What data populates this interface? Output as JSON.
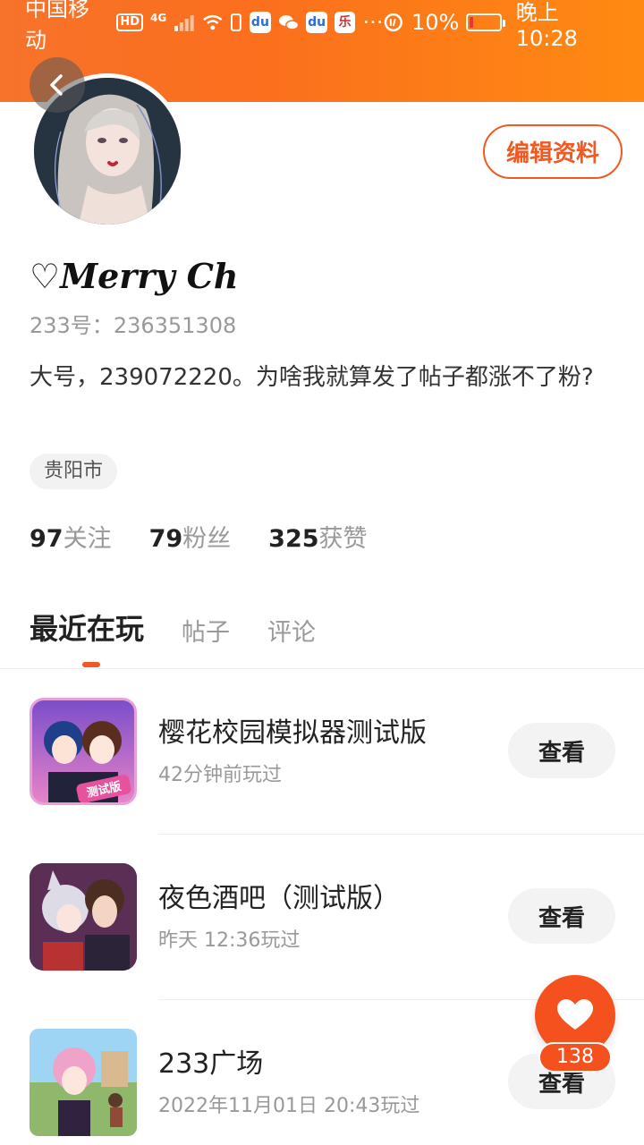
{
  "status_bar": {
    "carrier": "中国移动",
    "hd_badge": "HD",
    "network": "4G",
    "battery": "10%",
    "time": "晚上10:28",
    "overflow": "···"
  },
  "header": {
    "back_icon": "chevron-left-icon",
    "edit_label": "编辑资料"
  },
  "profile": {
    "nickname": "♡𝑴𝒆𝒓𝒓𝒚 𝑪𝒉",
    "uid_label": "233号：",
    "uid": "236351308",
    "bio": "大号，239072220。为啥我就算发了帖子都涨不了粉?",
    "city": "贵阳市"
  },
  "stats": [
    {
      "value": "97",
      "label": "关注"
    },
    {
      "value": "79",
      "label": "粉丝"
    },
    {
      "value": "325",
      "label": "获赞"
    }
  ],
  "tabs": [
    {
      "label": "最近在玩",
      "active": true
    },
    {
      "label": "帖子",
      "active": false
    },
    {
      "label": "评论",
      "active": false
    }
  ],
  "games": [
    {
      "title": "樱花校园模拟器测试版",
      "played": "42分钟前玩过",
      "button": "查看",
      "icon_text": "测试版"
    },
    {
      "title": "夜色酒吧（测试版）",
      "played": "昨天 12:36玩过",
      "button": "查看"
    },
    {
      "title": "233广场",
      "played": "2022年11月01日 20:43玩过",
      "button": "查看"
    }
  ],
  "like_fab": {
    "icon": "heart-icon",
    "count": "138"
  },
  "colors": {
    "accent": "#f05a22",
    "header_start": "#f7722a",
    "header_end": "#ff8a12"
  }
}
